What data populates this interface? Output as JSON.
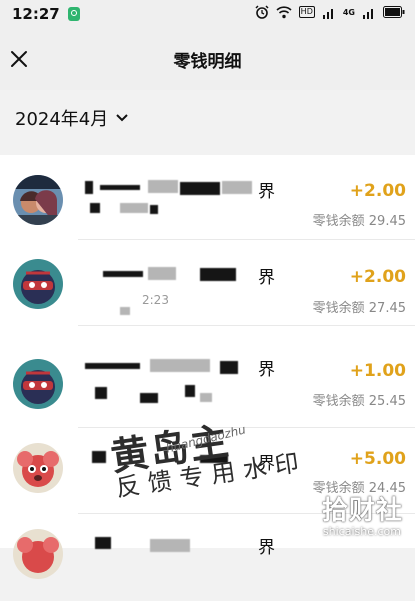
{
  "status": {
    "time": "12:27",
    "hd": "HD",
    "signal": "4G"
  },
  "nav": {
    "title": "零钱明细"
  },
  "filter": {
    "month": "2024年4月"
  },
  "transactions": [
    {
      "title_visible": "界",
      "amount": "+2.00",
      "balance": "零钱余额 29.45",
      "avatar": "couple-photo-avatar"
    },
    {
      "title_visible": "界",
      "amount": "+2.00",
      "balance": "零钱余额 27.45",
      "time_fragment": "2:23",
      "avatar": "ninja-avatar"
    },
    {
      "title_visible": "界",
      "amount": "+1.00",
      "balance": "零钱余额 25.45",
      "avatar": "ninja-avatar"
    },
    {
      "title_visible": "界",
      "amount": "+5.00",
      "balance": "零钱余额 24.45",
      "avatar": "koala-avatar"
    },
    {
      "title_visible": "界",
      "amount": "",
      "balance": "",
      "avatar": "koala-avatar"
    }
  ],
  "watermark": {
    "main": "黄岛主",
    "sub": "反馈专用水印",
    "url": "huangdaozhu"
  },
  "site_logo": {
    "name": "拾财社",
    "url": "shicaishe.com"
  },
  "colors": {
    "amount": "#e0a21b",
    "wechat_shield": "#2fb56f"
  }
}
